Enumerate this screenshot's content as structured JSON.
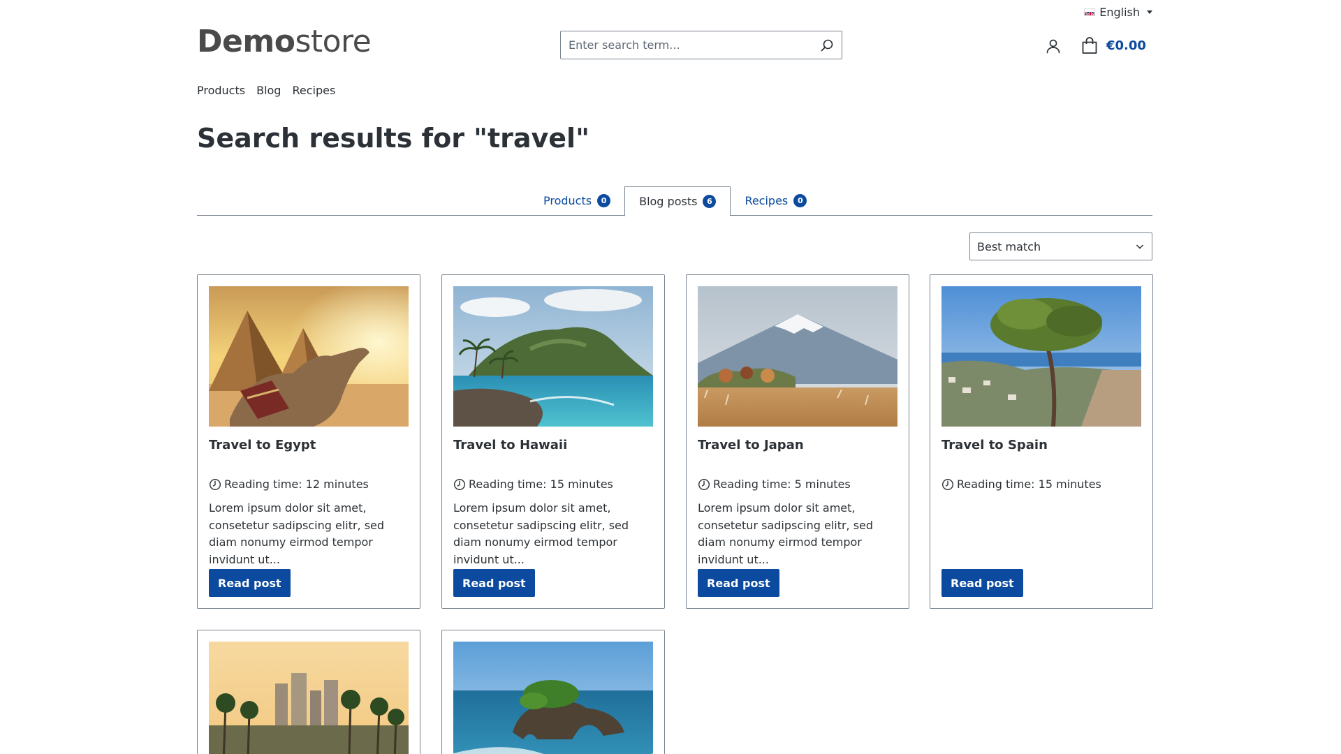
{
  "header": {
    "language": "English",
    "logo_bold": "Demo",
    "logo_light": "store",
    "search_placeholder": "Enter search term...",
    "cart_total": "€0.00"
  },
  "nav": {
    "items": [
      "Products",
      "Blog",
      "Recipes"
    ]
  },
  "page_title": "Search results for \"travel\"",
  "tabs": [
    {
      "label": "Products",
      "count": "0",
      "active": false
    },
    {
      "label": "Blog posts",
      "count": "6",
      "active": true
    },
    {
      "label": "Recipes",
      "count": "0",
      "active": false
    }
  ],
  "sort": {
    "selected": "Best match"
  },
  "posts": [
    {
      "title": "Travel to Egypt",
      "reading_time": "Reading time: 12 minutes",
      "excerpt": "Lorem ipsum dolor sit amet, consetetur sadipscing elitr, sed diam nonumy eirmod tempor invidunt ut...",
      "button": "Read post"
    },
    {
      "title": "Travel to Hawaii",
      "reading_time": "Reading time: 15 minutes",
      "excerpt": "Lorem ipsum dolor sit amet, consetetur sadipscing elitr, sed diam nonumy eirmod tempor invidunt ut...",
      "button": "Read post"
    },
    {
      "title": "Travel to Japan",
      "reading_time": "Reading time: 5 minutes",
      "excerpt": "Lorem ipsum dolor sit amet, consetetur sadipscing elitr, sed diam nonumy eirmod tempor invidunt ut...",
      "button": "Read post"
    },
    {
      "title": "Travel to Spain",
      "reading_time": "Reading time: 15 minutes",
      "excerpt": "",
      "button": "Read post"
    }
  ],
  "colors": {
    "primary": "#0b4a9e",
    "text": "#2b3136",
    "border": "#798490"
  }
}
